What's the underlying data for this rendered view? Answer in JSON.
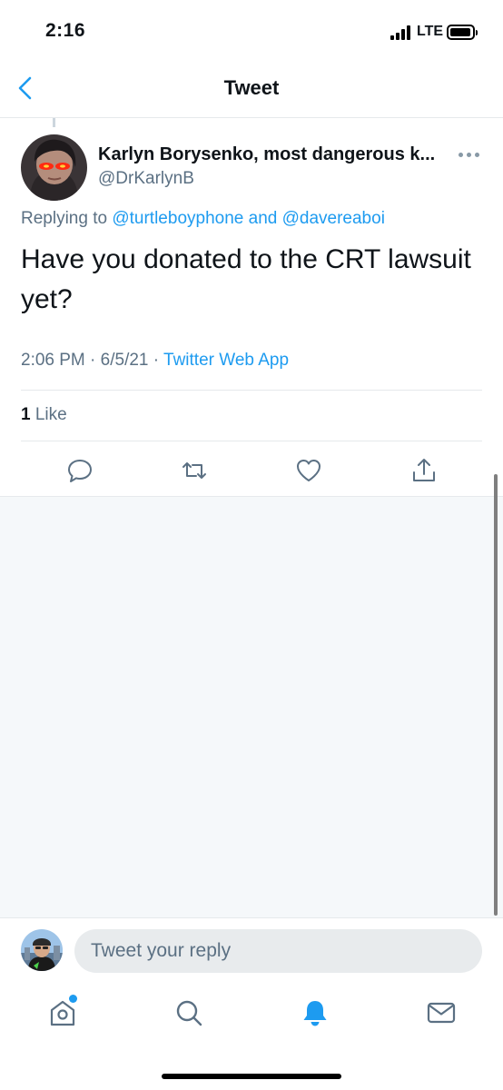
{
  "status_bar": {
    "time": "2:16",
    "network": "LTE"
  },
  "nav": {
    "title": "Tweet",
    "back_icon": "chevron-left-icon"
  },
  "tweet": {
    "author_name": "Karlyn Borysenko, most dangerous k...",
    "author_handle": "@DrKarlynB",
    "replying_prefix": "Replying to",
    "reply_to_1": "@turtleboyphone",
    "reply_and": "and",
    "reply_to_2": "@davereaboi",
    "text": "Have you donated to the CRT lawsuit yet?",
    "time": "2:06 PM",
    "separator": "·",
    "date": "6/5/21",
    "source": "Twitter Web App",
    "likes_count": "1",
    "likes_label": "Like",
    "actions": [
      "reply-icon",
      "retweet-icon",
      "like-icon",
      "share-icon"
    ]
  },
  "reply_bar": {
    "placeholder": "Tweet your reply"
  },
  "tab_bar": {
    "items": [
      "home-icon",
      "search-icon",
      "notifications-icon",
      "messages-icon"
    ],
    "active": "notifications-icon"
  },
  "colors": {
    "accent": "#1d9bf0",
    "secondary_text": "#5b7083",
    "divider": "#e6e9ec",
    "background_gray": "#f5f8fa"
  }
}
